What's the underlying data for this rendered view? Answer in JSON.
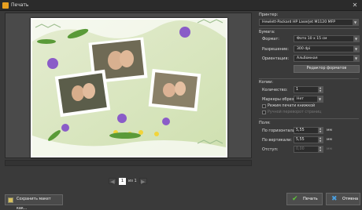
{
  "window": {
    "title": "Печать"
  },
  "pager": {
    "current_page": "1",
    "of_label": "из 1"
  },
  "printer": {
    "section_label": "Принтер:",
    "selected": "Hewlett-Packard HP LaserJet M1120 MFP"
  },
  "paper": {
    "section_label": "Бумага:",
    "format_label": "Формат:",
    "format_value": "Фото 10 x 15 см",
    "resolution_label": "Разрешение:",
    "resolution_value": "300 dpi",
    "orientation_label": "Ориентация:",
    "orientation_value": "Альбомная",
    "editor_button": "Редактор форматов"
  },
  "copies": {
    "section_label": "Копии:",
    "quantity_label": "Количество:",
    "quantity_value": "1",
    "crop_marks_label": "Маркеры обрезки:",
    "crop_marks_value": "Нет",
    "book_mode_label": "Режим печати книжкой",
    "manual_flip_label": "Ручной переворот страниц"
  },
  "margins": {
    "section_label": "Поля:",
    "horizontal_label": "По горизонтали:",
    "horizontal_value": "5,55",
    "vertical_label": "По вертикали:",
    "vertical_value": "5,55",
    "indent_label": "Отступ:",
    "indent_value": "0,00",
    "unit": "мм"
  },
  "footer": {
    "save_layout": "Сохранить макет как...",
    "print": "Печать",
    "cancel": "Отмена"
  },
  "colors": {
    "accent_green": "#5ec23a",
    "accent_blue": "#4a9fe0"
  }
}
